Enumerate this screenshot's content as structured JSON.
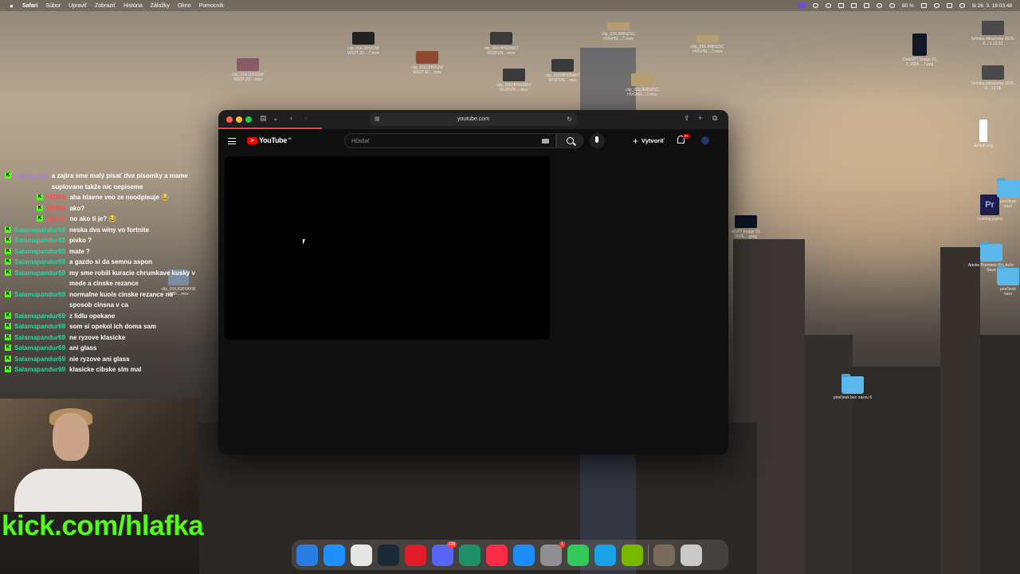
{
  "menubar": {
    "apple": "",
    "items": [
      "Safari",
      "Súbor",
      "Upraviť",
      "Zobraziť",
      "História",
      "Záložky",
      "Okno",
      "Pomocník"
    ],
    "battery": "80 %",
    "datetime": "št 26. 3.  19:03:48"
  },
  "desktop_icons": [
    {
      "label": "clip_01KJ3HZGW WS3T.JD....mov"
    },
    {
      "label": "clip_01KJ3HZGW WS3T.JD....7.mov"
    },
    {
      "label": "clip_01KJ3HZGW WS3T.JD....mov"
    },
    {
      "label": "clip_01KHP6SWKT 6FDDVN....mov"
    },
    {
      "label": "clip_01KHP6SWKT 6FDDVN....mov"
    },
    {
      "label": "clip_01KHP6SWKT 6FDDVN....mov"
    },
    {
      "label": "clip_01KJR8NZSC HVGHG....7.mov"
    },
    {
      "label": "clip_01KJR8NZSC HVGHG....2.mov"
    },
    {
      "label": "clip_01KJR8NZSC HVGHG....7.mov"
    },
    {
      "label": "ChatGPT Image 21. 2_2026....7.png"
    },
    {
      "label": "Snímka obrazovky 2026-0....1.12.51"
    },
    {
      "label": "Snímka obrazovky 2026-0....13.06"
    },
    {
      "label": "default.png"
    },
    {
      "label": "cooking.prproj"
    },
    {
      "label": "Adobe Premiere Pro Auto-Save"
    },
    {
      "label": "priečinok bez názvu 6"
    },
    {
      "label": "priečinok názv"
    },
    {
      "label": "priečinok názv"
    },
    {
      "label": "atGPT Image 21. 2026,....jpeg"
    },
    {
      "label": "clip_01KJGBYAYW WBF....mov"
    }
  ],
  "chat": [
    {
      "user": "qbshen123",
      "text": "a zajtra sme malý písať dve písomky a mame suplovane takže nic nepiseme",
      "color": "#b07be0"
    },
    {
      "user": "SI7MA",
      "text": "aha hlavne veo ze neodpisuje 😂",
      "color": "#ff4d4d"
    },
    {
      "user": "SI7MA",
      "text": "ako?",
      "color": "#ff4d4d"
    },
    {
      "user": "SI7MA",
      "text": "no ako ti je? 😂",
      "color": "#ff4d4d"
    },
    {
      "user": "Salamapandur69",
      "text": "neska dva winy vo fortnite",
      "color": "#2fd6a3"
    },
    {
      "user": "Salamapandur69",
      "text": "pivko ?",
      "color": "#2fd6a3"
    },
    {
      "user": "Salamapandur69",
      "text": "mate ?",
      "color": "#2fd6a3"
    },
    {
      "user": "Salamapandur69",
      "text": "a gazdo si da semnu aspon",
      "color": "#2fd6a3"
    },
    {
      "user": "Salamapandur69",
      "text": "my sme robili kuracie chrumkave kusky v mede a cinske rezance",
      "color": "#2fd6a3"
    },
    {
      "user": "Salamapandur69",
      "text": "normalne kuois cinske rezance na sposob cinsna v ca",
      "color": "#2fd6a3"
    },
    {
      "user": "Salamapandur69",
      "text": "z lidlu opekane",
      "color": "#2fd6a3"
    },
    {
      "user": "Salamapandur69",
      "text": "som si opekol ich doma sam",
      "color": "#2fd6a3"
    },
    {
      "user": "Salamapandur69",
      "text": "ne ryzove klasicke",
      "color": "#2fd6a3"
    },
    {
      "user": "Salamapandur69",
      "text": "ani glass",
      "color": "#2fd6a3"
    },
    {
      "user": "Salamapandur69",
      "text": "nie ryzove ani glass",
      "color": "#2fd6a3"
    },
    {
      "user": "Salamapandur69",
      "text": "klasicke cibske slm mal",
      "color": "#2fd6a3"
    }
  ],
  "stream": {
    "url_text": "kick.com/hlafka"
  },
  "safari": {
    "address": "youtube.com"
  },
  "youtube": {
    "logo": "YouTube",
    "country": "SK",
    "search_placeholder": "Hľadať",
    "create_label": "Vytvoriť",
    "notifications": "9+"
  },
  "dock": {
    "apps": [
      {
        "name": "finder-icon",
        "color": "#2a7de1"
      },
      {
        "name": "safari-icon",
        "color": "#1e90ff"
      },
      {
        "name": "launchpad-icon",
        "color": "#e6e6e6"
      },
      {
        "name": "steam-icon",
        "color": "#1b2838"
      },
      {
        "name": "opera-icon",
        "color": "#e01b2c"
      },
      {
        "name": "discord-icon",
        "color": "#5865f2",
        "badge": "128"
      },
      {
        "name": "obs-icon",
        "color": "#1f8f6a"
      },
      {
        "name": "music-icon",
        "color": "#fa2d48"
      },
      {
        "name": "app-store-icon",
        "color": "#1b8cf8"
      },
      {
        "name": "system-settings-icon",
        "color": "#8e8e93",
        "badge": "1"
      },
      {
        "name": "facetime-icon",
        "color": "#34c759"
      },
      {
        "name": "quicktime-icon",
        "color": "#1aa1e8"
      },
      {
        "name": "nvidia-icon",
        "color": "#76b900"
      },
      {
        "name": "stack-icon",
        "color": "#7b6b5a"
      },
      {
        "name": "trash-icon",
        "color": "#c9c9c9"
      }
    ]
  }
}
